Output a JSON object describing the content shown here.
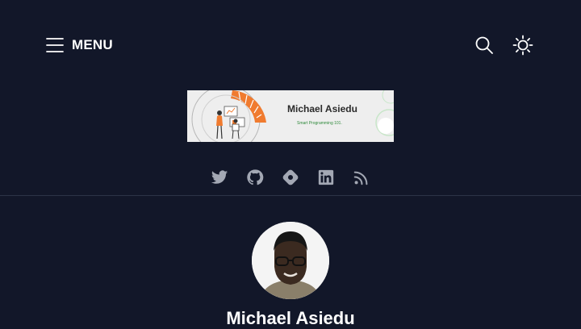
{
  "header": {
    "menu_label": "MENU",
    "menu_icon": "hamburger-icon",
    "search_icon": "search-icon",
    "theme_icon": "sun-icon"
  },
  "banner": {
    "name": "Michael Asiedu",
    "tagline": "Smart Programming 101."
  },
  "social_links": [
    {
      "icon": "twitter-icon"
    },
    {
      "icon": "github-icon"
    },
    {
      "icon": "hashnode-icon"
    },
    {
      "icon": "linkedin-icon"
    },
    {
      "icon": "rss-icon"
    }
  ],
  "author": {
    "name": "Michael Asiedu"
  },
  "colors": {
    "background": "#121729",
    "text": "#ffffff",
    "icon_muted": "#a3a8b4",
    "banner_accent": "#f07b2f",
    "banner_tagline": "#2f8a3b",
    "divider": "#2c3347"
  }
}
